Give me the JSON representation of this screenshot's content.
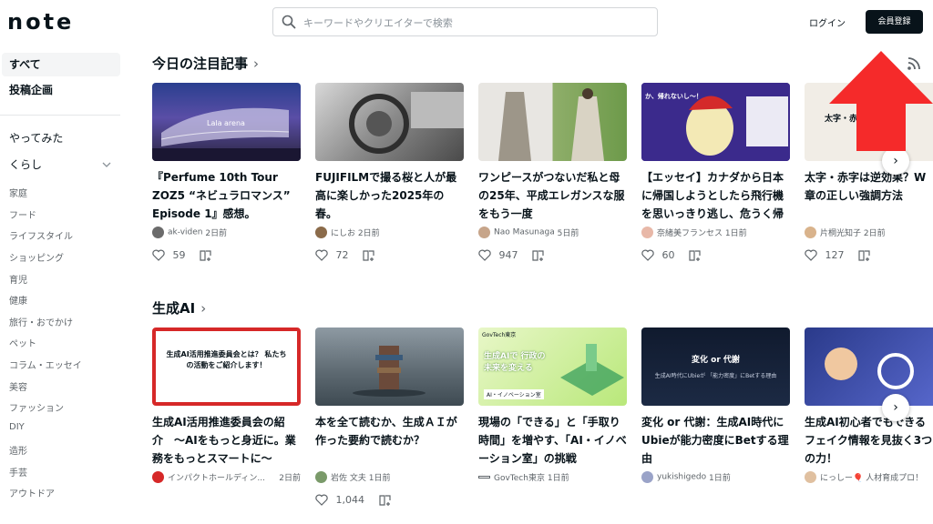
{
  "header": {
    "logo": "note",
    "search_placeholder": "キーワードやクリエイターで検索",
    "login": "ログイン",
    "signup": "会員登録"
  },
  "sidebar": {
    "top": [
      {
        "label": "すべて",
        "active": true
      },
      {
        "label": "投稿企画"
      }
    ],
    "groups": [
      {
        "label": "やってみた"
      },
      {
        "label": "くらし"
      }
    ],
    "subitems": [
      "家庭",
      "フード",
      "ライフスタイル",
      "ショッピング",
      "育児",
      "健康",
      "旅行・おでかけ",
      "ペット",
      "コラム・エッセイ",
      "美容",
      "ファッション",
      "DIY",
      "造形",
      "手芸",
      "アウトドア"
    ]
  },
  "sections": [
    {
      "title": "今日の注目記事",
      "cards": [
        {
          "title": "『Perfume 10th Tour ZOZ5 “ネビュラロマンス” Episode 1』感想。",
          "author": "ak-viden",
          "time": "2日前",
          "likes": "59",
          "thumb_text": "Lala arena"
        },
        {
          "title": "FUJIFILMで撮る桜と人が最高に楽しかった2025年の春。",
          "author": "にしお",
          "time": "2日前",
          "likes": "72",
          "thumb_text": ""
        },
        {
          "title": "ワンピースがつないだ私と母の25年、平成エレガンスな服をもう一度",
          "author": "Nao Masunaga",
          "time": "5日前",
          "likes": "947",
          "thumb_text": ""
        },
        {
          "title": "【エッセイ】カナダから日本に帰国しようとしたら飛行機を思いっきり逃し、危うく帰っ...",
          "author": "奈緒美フランセス",
          "time": "1日前",
          "likes": "60",
          "thumb_text": "か、帰れないし〜！"
        },
        {
          "title": "太字・赤字は逆効果？W章の正しい強調方法",
          "author": "片桐光知子",
          "time": "2日前",
          "likes": "127",
          "thumb_text": "太字・赤 Web文"
        }
      ]
    },
    {
      "title": "生成AI",
      "cards": [
        {
          "title": "生成AI活用推進委員会の紹介　〜AIをもっと身近に。業務をもっとスマートに〜",
          "author": "インパクトホールディン...",
          "time": "2日前",
          "likes": "",
          "thumb_text": "生成AI活用推進委員会とは？ 私たちの活動をご紹介します！"
        },
        {
          "title": "本を全て読むか、生成ＡＩが作った要約で読むか？",
          "author": "岩佐 文夫",
          "time": "1日前",
          "likes": "1,044",
          "thumb_text": ""
        },
        {
          "title": "現場の「できる」と「手取り時間」を増やす、「AI・イノベーション室」の挑戦",
          "author": "GovTech東京",
          "time": "1日前",
          "likes": "",
          "thumb_text": "生成AIで 行政の未来を変える"
        },
        {
          "title": "変化 or 代謝：生成AI時代にUbieが能力密度にBetする理由",
          "author": "yukishigedo",
          "time": "1日前",
          "likes": "",
          "thumb_text": "変化 or 代謝"
        },
        {
          "title": "生成AI初心者でもできるフェイク情報を見抜く3つの力！",
          "author": "にっしー🎈 人材育成プロ！",
          "time": "",
          "likes": "",
          "thumb_text": ""
        }
      ]
    }
  ],
  "labels": {
    "govtech_tag": "GovTech東京",
    "ai_tag": "AI・イノベーション室",
    "ubie_sub": "生成AI時代にUbieが 「能力密度」にBetする理由"
  },
  "colors": {
    "accent_dark": "#08131a",
    "arrow_red": "#f52a2a",
    "border": "#d3d6d9"
  }
}
